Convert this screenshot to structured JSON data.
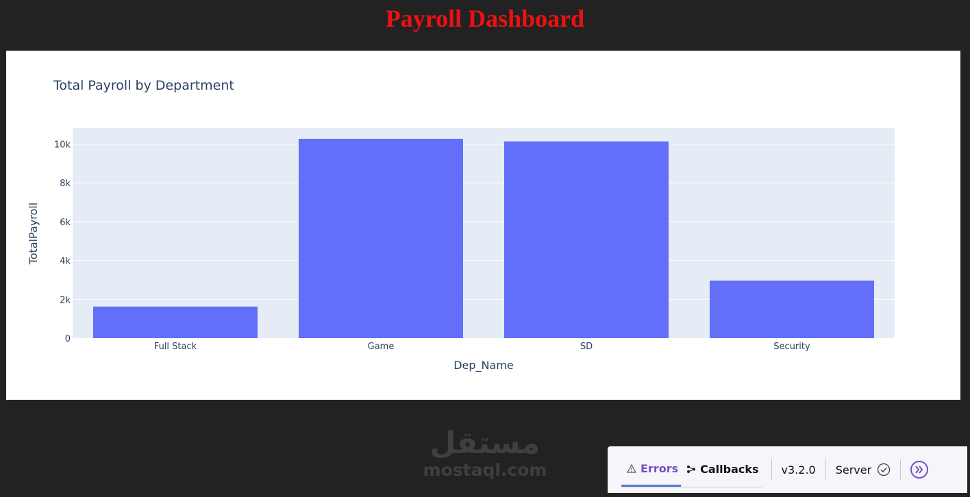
{
  "page": {
    "title": "Payroll Dashboard"
  },
  "chart_data": {
    "type": "bar",
    "title": "Total Payroll by Department",
    "xlabel": "Dep_Name",
    "ylabel": "TotalPayroll",
    "categories": [
      "Full Stack",
      "Game",
      "SD",
      "Security"
    ],
    "values": [
      1630,
      10270,
      10140,
      2970
    ],
    "ylim": [
      0,
      10830
    ],
    "yticks": [
      0,
      2000,
      4000,
      6000,
      8000,
      10000
    ],
    "ytick_labels": [
      "0",
      "2k",
      "4k",
      "6k",
      "8k",
      "10k"
    ],
    "grid": true,
    "bar_color": "#636efa",
    "plot_bg": "#e5ecf6"
  },
  "watermark": {
    "arabic": "مستقل",
    "latin": "mostaql.com"
  },
  "devtools": {
    "errors_label": "Errors",
    "errors_icon": "warning-icon",
    "callbacks_label": "Callbacks",
    "callbacks_icon": "callback-graph-icon",
    "version": "v3.2.0",
    "server_label": "Server",
    "server_icon": "check-circle-icon",
    "expand_icon": "double-chevron-right-icon",
    "accent": "#7a4fc2"
  }
}
